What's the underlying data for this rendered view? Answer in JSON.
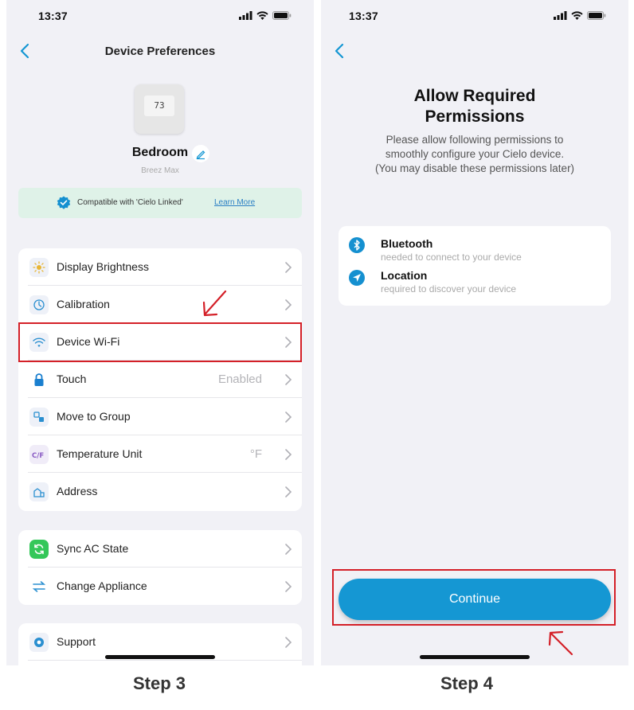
{
  "left_screen": {
    "status_time": "13:37",
    "nav_title": "Device Preferences",
    "device": {
      "display": "73",
      "name": "Bedroom",
      "model": "Breez Max"
    },
    "compat_banner": {
      "text": "Compatible with 'Cielo Linked'",
      "link": "Learn More",
      "color": "#dff2e8"
    },
    "settings_group_1": [
      {
        "label": "Display Brightness",
        "value": "",
        "icon": "sun-icon"
      },
      {
        "label": "Calibration",
        "value": "",
        "icon": "calibration-icon"
      },
      {
        "label": "Device Wi-Fi",
        "value": "",
        "icon": "wifi-icon",
        "highlighted": true
      },
      {
        "label": "Touch",
        "value": "Enabled",
        "icon": "lock-icon"
      },
      {
        "label": "Move to Group",
        "value": "",
        "icon": "group-icon"
      },
      {
        "label": "Temperature Unit",
        "value": "°F",
        "icon": "temperature-unit-icon"
      },
      {
        "label": "Address",
        "value": "",
        "icon": "address-icon"
      }
    ],
    "settings_group_2": [
      {
        "label": "Sync AC State",
        "value": "",
        "icon": "sync-icon"
      },
      {
        "label": "Change Appliance",
        "value": "",
        "icon": "swap-icon"
      }
    ],
    "settings_group_3": [
      {
        "label": "Support",
        "value": "",
        "icon": "support-icon"
      }
    ],
    "step_label": "Step 3"
  },
  "right_screen": {
    "status_time": "13:37",
    "title": "Allow Required Permissions",
    "description_lines": [
      "Please allow following permissions to",
      "smoothly configure your Cielo device.",
      "(You may disable these permissions later)"
    ],
    "permissions": [
      {
        "name": "Bluetooth",
        "desc": "needed to connect to your device",
        "icon": "bluetooth-icon"
      },
      {
        "name": "Location",
        "desc": "required to discover your device",
        "icon": "location-icon"
      }
    ],
    "continue_label": "Continue",
    "step_label": "Step 4"
  },
  "colors": {
    "accent": "#1597d3",
    "highlight": "#d42028",
    "background": "#f1f1f6"
  }
}
